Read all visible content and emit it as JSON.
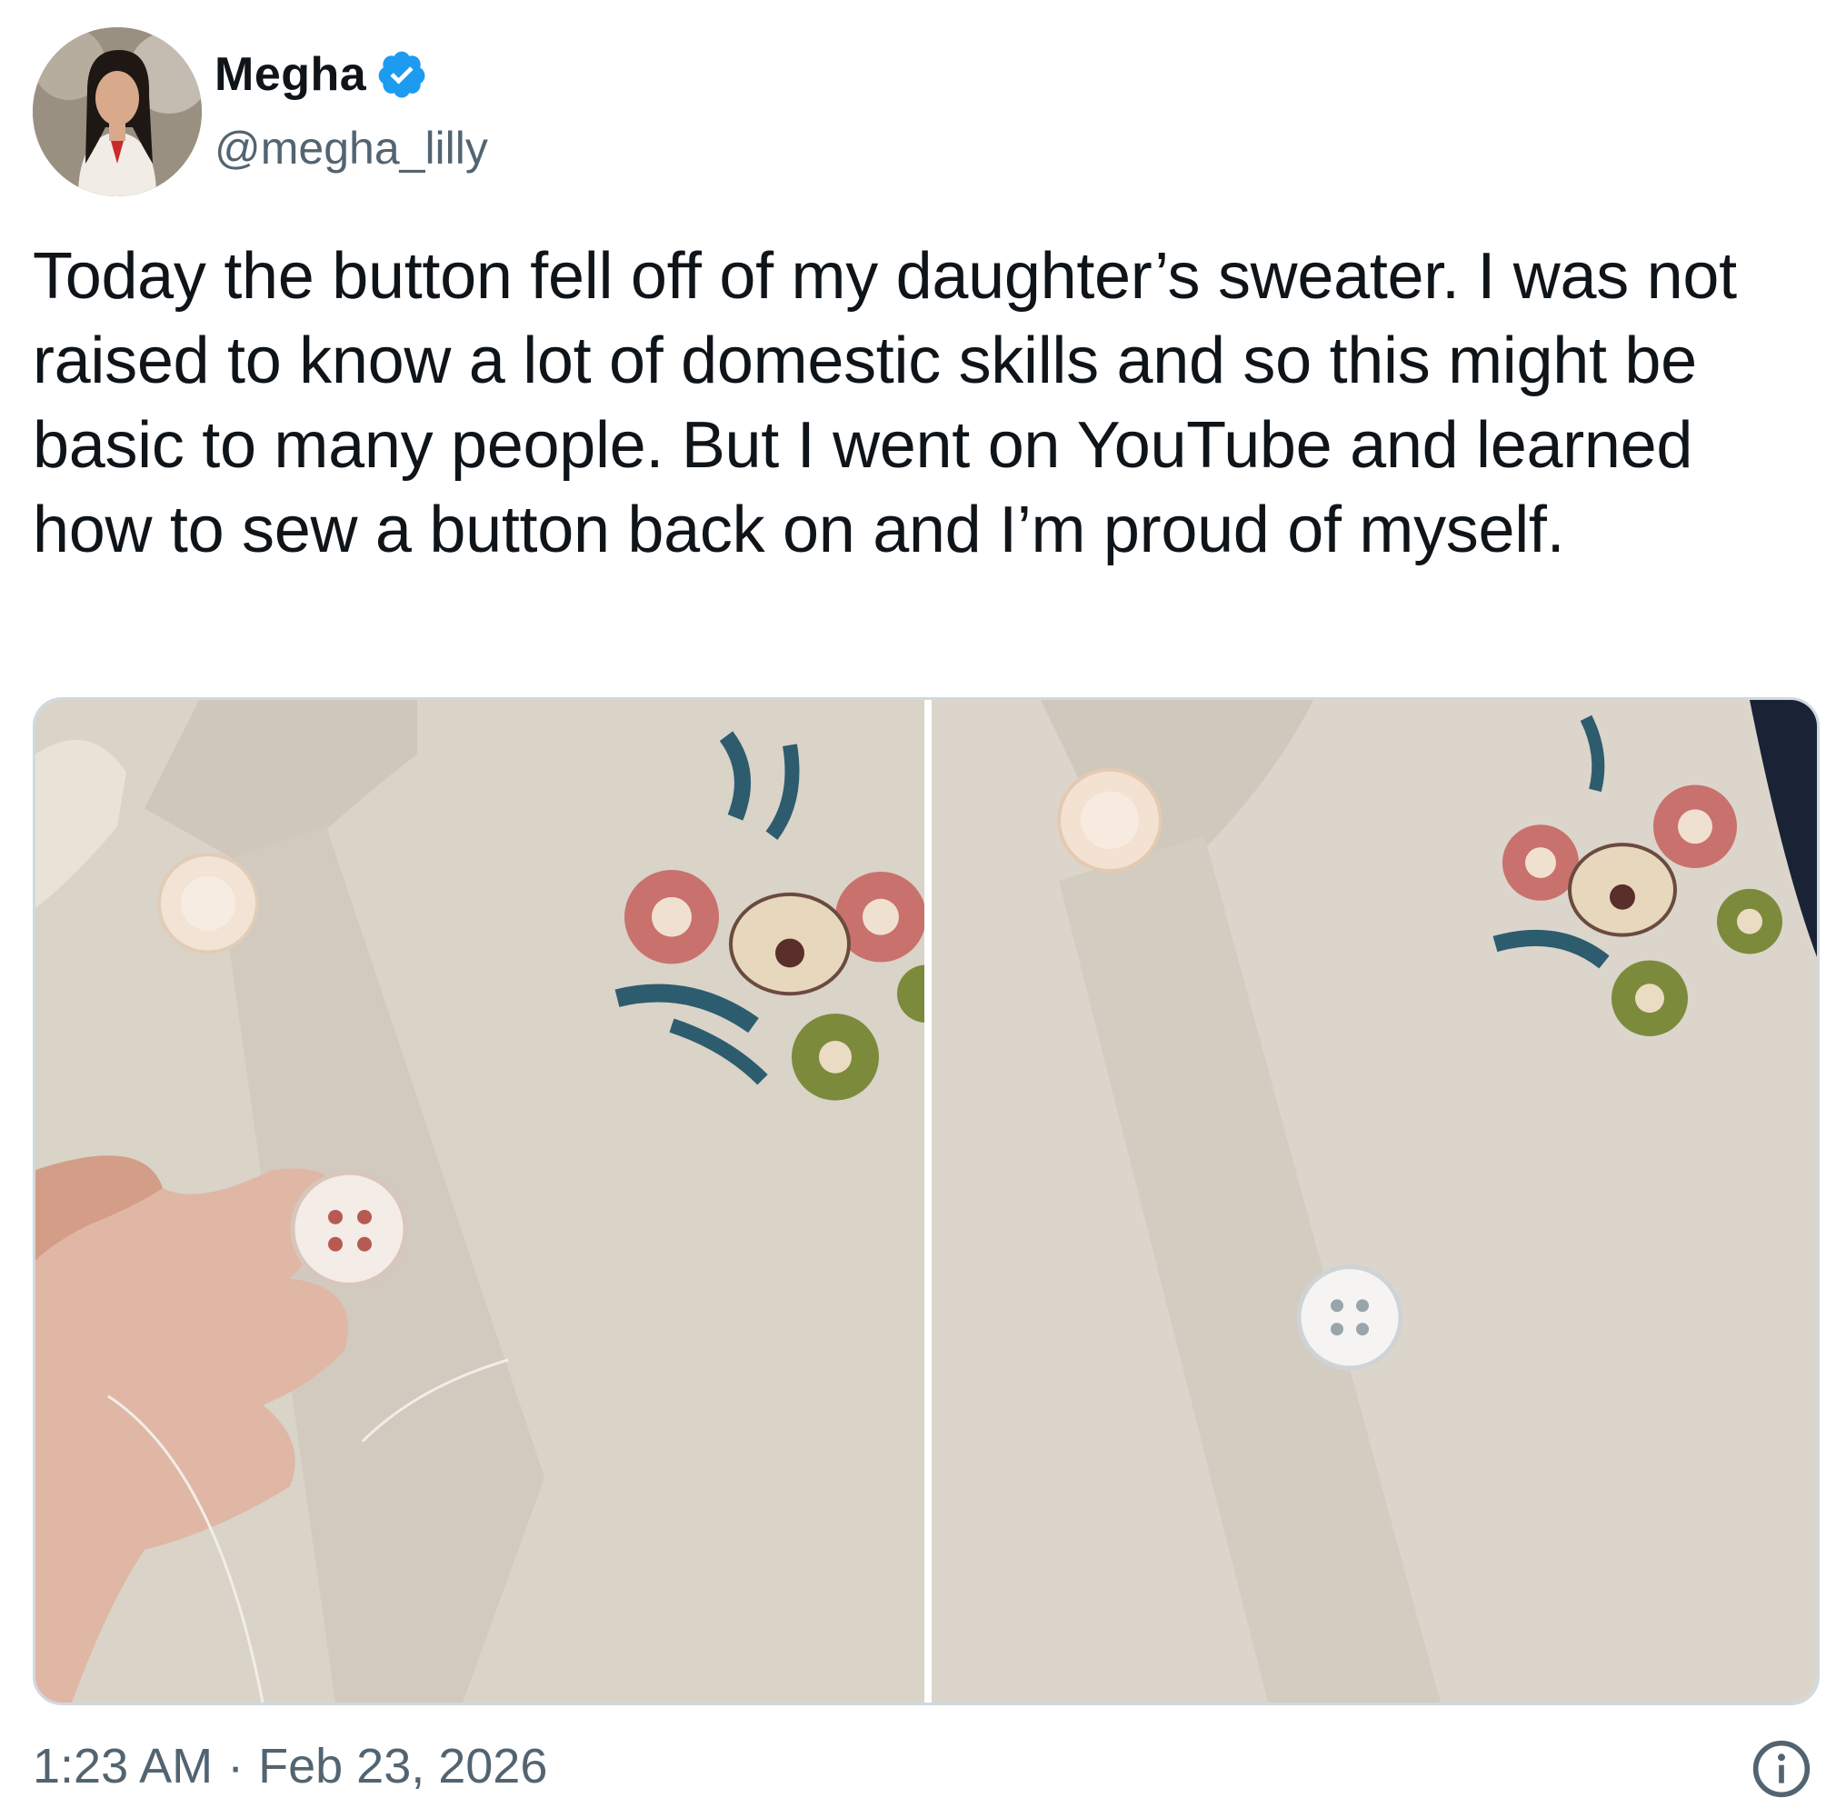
{
  "author": {
    "display_name": "Megha",
    "handle": "@megha_lilly",
    "verified": true,
    "verified_color": "#1d9bf0"
  },
  "tweet": {
    "text": "Today the button fell off of my daughter’s sweater. I was not raised to know a lot of domestic skills and so this might be basic to many people. But I went on YouTube and learned how to sew a button back on and I’m proud of myself."
  },
  "media": [
    {
      "description_icon": "photo-sweater-button-in-hand"
    },
    {
      "description_icon": "photo-sweater-button-sewn"
    }
  ],
  "meta": {
    "time": "1:23 AM",
    "separator": "·",
    "date": "Feb 23, 2026"
  },
  "icons": {
    "verified": "verified-badge-icon",
    "info": "info-icon"
  },
  "colors": {
    "text": "#0f1419",
    "secondary": "#536471",
    "border": "#cfd9de",
    "sweater": "#ddd6cc"
  }
}
